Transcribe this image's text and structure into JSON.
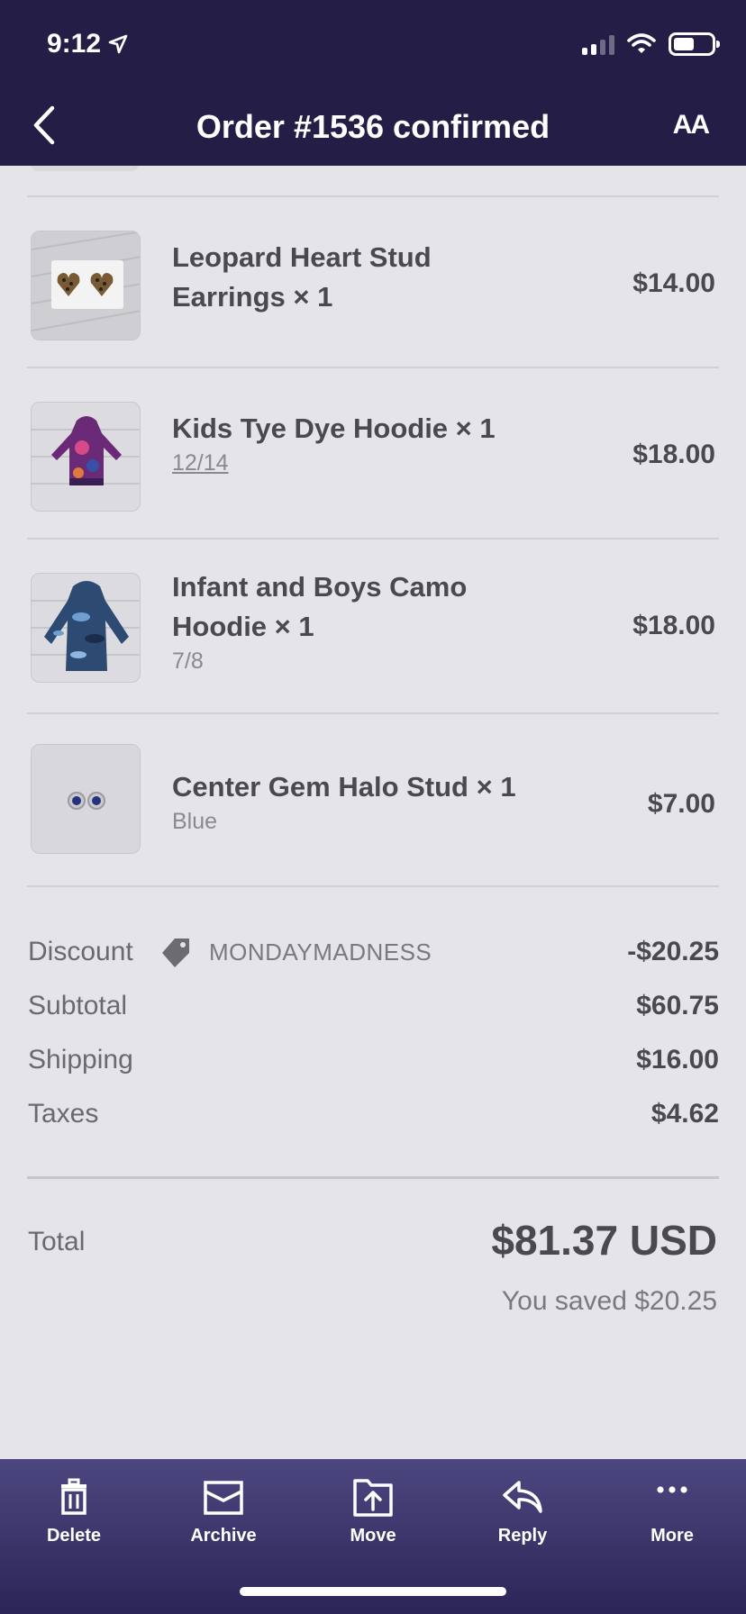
{
  "status_bar": {
    "time": "9:12"
  },
  "nav": {
    "title": "Order #1536 confirmed",
    "font_size_label": "AA"
  },
  "items": [
    {
      "name": "Leopard Heart Stud Earrings × 1",
      "variant": "",
      "price": "$14.00",
      "image": "leopard-heart-earrings"
    },
    {
      "name": "Kids Tye Dye Hoodie × 1",
      "variant": "12/14",
      "price": "$18.00",
      "image": "tie-dye-hoodie"
    },
    {
      "name": "Infant and Boys Camo Hoodie × 1",
      "variant": "7/8",
      "price": "$18.00",
      "image": "camo-hoodie"
    },
    {
      "name": "Center Gem Halo Stud × 1",
      "variant": "Blue",
      "price": "$7.00",
      "image": "gem-halo-stud"
    }
  ],
  "summary": {
    "discount": {
      "label": "Discount",
      "code": "MONDAYMADNESS",
      "value": "-$20.25"
    },
    "subtotal": {
      "label": "Subtotal",
      "value": "$60.75"
    },
    "shipping": {
      "label": "Shipping",
      "value": "$16.00"
    },
    "taxes": {
      "label": "Taxes",
      "value": "$4.62"
    }
  },
  "total": {
    "label": "Total",
    "value": "$81.37 USD",
    "saved": "You saved $20.25"
  },
  "toolbar": {
    "delete": "Delete",
    "archive": "Archive",
    "move": "Move",
    "reply": "Reply",
    "more": "More"
  },
  "colors": {
    "header_bg": "#241d45",
    "toolbar_bg": "#3d3770",
    "page_bg": "#e4e4e9"
  }
}
